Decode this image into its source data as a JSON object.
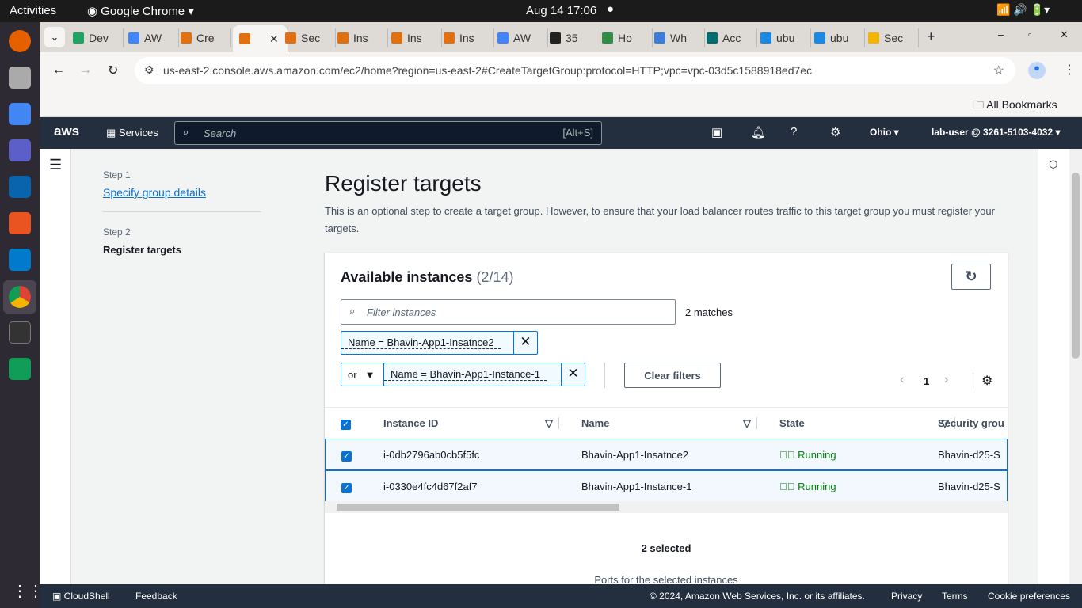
{
  "system": {
    "activities": "Activities",
    "app": "Google Chrome",
    "clock": "Aug 14  17:06"
  },
  "tabs": [
    {
      "label": "Dev",
      "color": "#1fa463"
    },
    {
      "label": "AW",
      "color": "#4285f4"
    },
    {
      "label": "Cre",
      "color": "#e07010"
    },
    {
      "label": "",
      "color": "#e07010"
    },
    {
      "label": "Sec",
      "color": "#e07010"
    },
    {
      "label": "Ins",
      "color": "#e07010"
    },
    {
      "label": "Ins",
      "color": "#e07010"
    },
    {
      "label": "Ins",
      "color": "#e07010"
    },
    {
      "label": "AW",
      "color": "#4285f4"
    },
    {
      "label": "35",
      "color": "#222"
    },
    {
      "label": "Ho",
      "color": "#2f8d46"
    },
    {
      "label": "Wh",
      "color": "#3b7dd8"
    },
    {
      "label": "Acc",
      "color": "#036c70"
    },
    {
      "label": "ubu",
      "color": "#1e88e5"
    },
    {
      "label": "ubu",
      "color": "#1e88e5"
    },
    {
      "label": "Sec",
      "color": "#f4b400"
    }
  ],
  "browser": {
    "url": "us-east-2.console.aws.amazon.com/ec2/home?region=us-east-2#CreateTargetGroup:protocol=HTTP;vpc=vpc-03d5c1588918ed7ec",
    "bookmarks": "All Bookmarks"
  },
  "aws": {
    "logo": "aws",
    "services": "Services",
    "search_placeholder": "Search",
    "shortcut": "[Alt+S]",
    "region": "Ohio",
    "user": "lab-user @ 3261-5103-4032"
  },
  "steps": [
    {
      "step": "Step 1",
      "label": "Specify group details"
    },
    {
      "step": "Step 2",
      "label": "Register targets"
    }
  ],
  "page": {
    "title": "Register targets",
    "desc": "This is an optional step to create a target group. However, to ensure that your load balancer routes traffic to this target group you must register your targets."
  },
  "instances": {
    "title": "Available instances",
    "count": "(2/14)",
    "filter_placeholder": "Filter instances",
    "matches": "2 matches",
    "token1": "Name = Bhavin-App1-Insatnce2",
    "operator": "or",
    "token2": "Name = Bhavin-App1-Instance-1",
    "clear": "Clear filters",
    "page": "1",
    "columns": [
      "Instance ID",
      "Name",
      "State",
      "Security grou"
    ],
    "rows": [
      {
        "id": "i-0db2796ab0cb5f5fc",
        "name": "Bhavin-App1-Insatnce2",
        "state": "Running",
        "sg": "Bhavin-d25-S"
      },
      {
        "id": "i-0330e4fc4d67f2af7",
        "name": "Bhavin-App1-Instance-1",
        "state": "Running",
        "sg": "Bhavin-d25-S"
      }
    ],
    "selected": "2 selected",
    "ports": "Ports for the selected instances"
  },
  "footer": {
    "cloudshell": "CloudShell",
    "feedback": "Feedback",
    "copyright": "© 2024, Amazon Web Services, Inc. or its affiliates.",
    "privacy": "Privacy",
    "terms": "Terms",
    "cookies": "Cookie preferences"
  }
}
